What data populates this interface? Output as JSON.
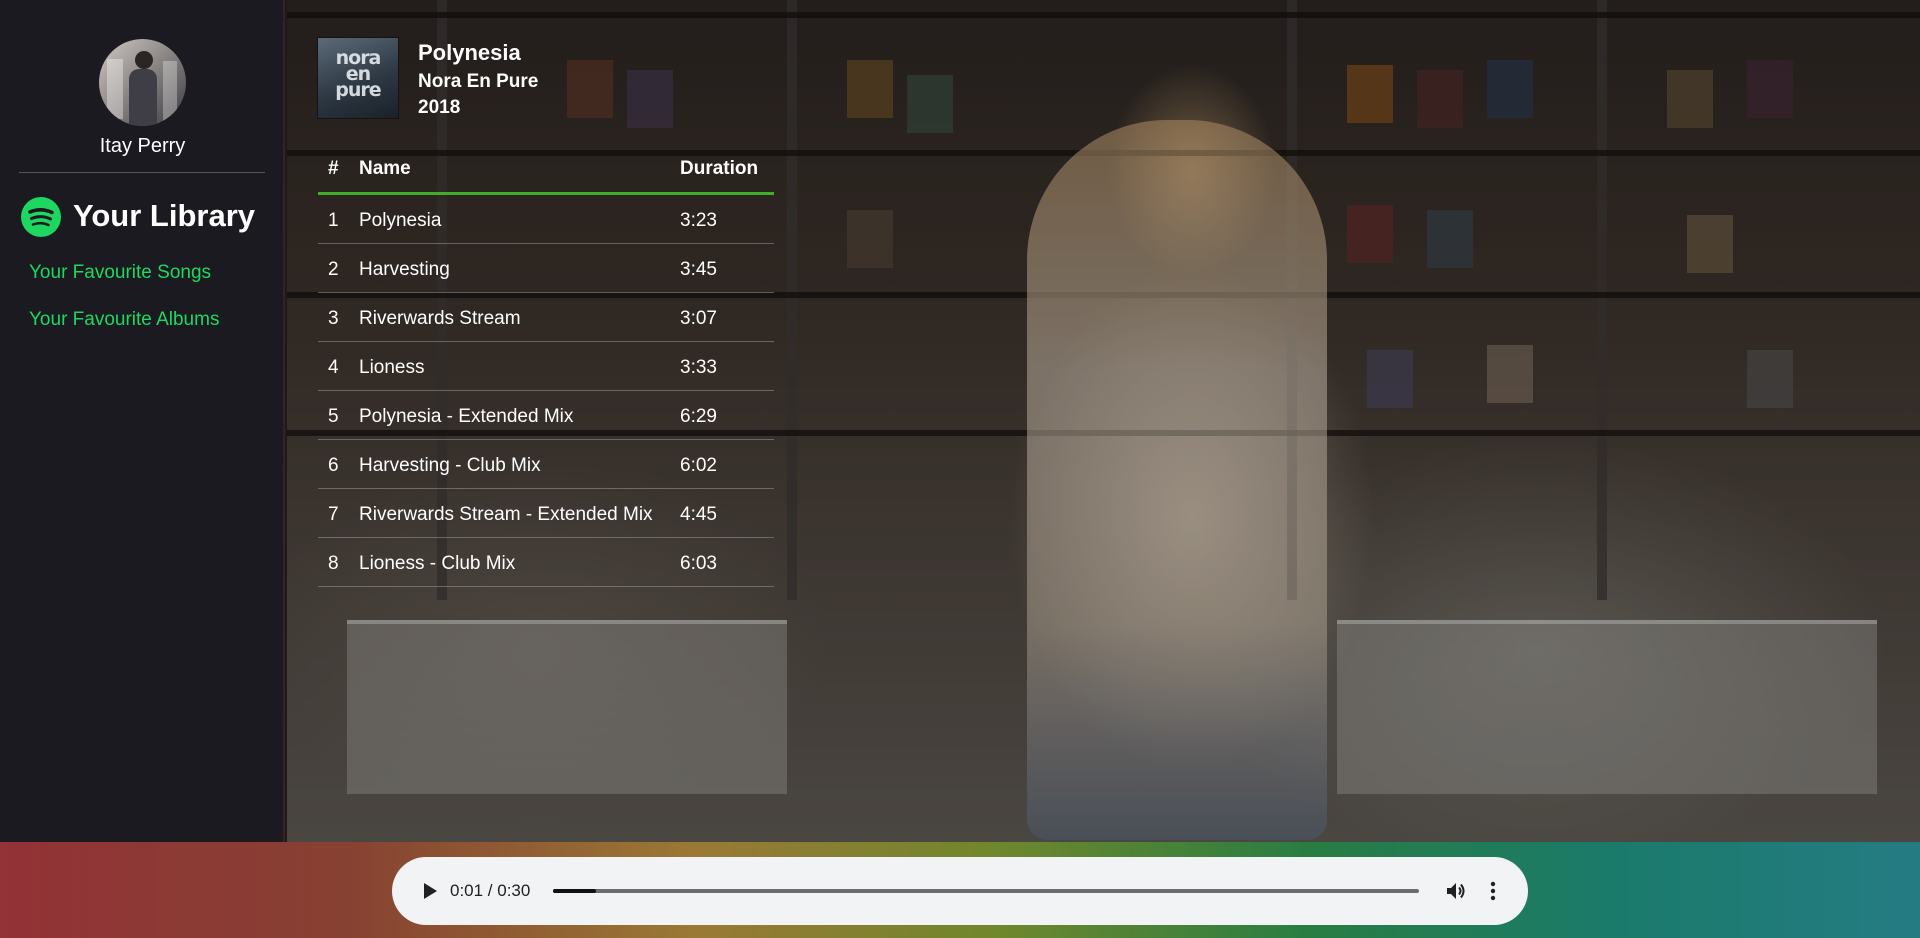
{
  "sidebar": {
    "username": "Itay Perry",
    "library_title": "Your Library",
    "nav": [
      "Your Favourite Songs",
      "Your Favourite Albums"
    ]
  },
  "album": {
    "cover_text": [
      "nora",
      "en",
      "pure"
    ],
    "title": "Polynesia",
    "artist": "Nora En Pure",
    "year": "2018"
  },
  "tracks": {
    "headers": {
      "num": "#",
      "name": "Name",
      "duration": "Duration"
    },
    "rows": [
      {
        "num": "1",
        "name": "Polynesia",
        "duration": "3:23"
      },
      {
        "num": "2",
        "name": "Harvesting",
        "duration": "3:45"
      },
      {
        "num": "3",
        "name": "Riverwards Stream",
        "duration": "3:07"
      },
      {
        "num": "4",
        "name": "Lioness",
        "duration": "3:33"
      },
      {
        "num": "5",
        "name": "Polynesia - Extended Mix",
        "duration": "6:29"
      },
      {
        "num": "6",
        "name": "Harvesting - Club Mix",
        "duration": "6:02"
      },
      {
        "num": "7",
        "name": "Riverwards Stream - Extended Mix",
        "duration": "4:45"
      },
      {
        "num": "8",
        "name": "Lioness - Club Mix",
        "duration": "6:03"
      }
    ]
  },
  "player": {
    "time": "0:01 / 0:30",
    "progress": 0.05,
    "icons": {
      "play": "play-icon",
      "volume": "volume-icon",
      "more": "more-vert-icon"
    }
  },
  "colors": {
    "accent": "#1ed760",
    "table_underline": "#3fae2a",
    "sidebar_bg": "#1b1a20"
  }
}
